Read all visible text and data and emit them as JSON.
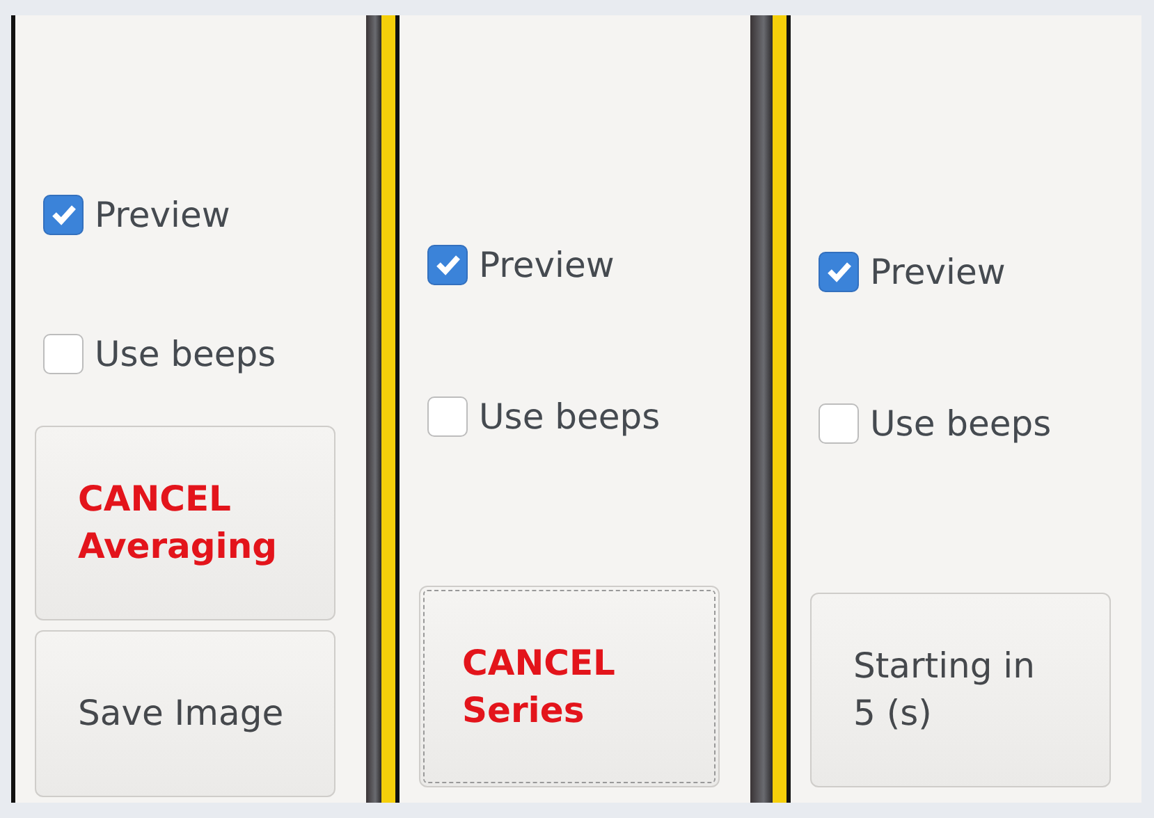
{
  "panels": [
    {
      "checkboxes": [
        {
          "label": "Preview",
          "checked": true
        },
        {
          "label": "Use beeps",
          "checked": false
        }
      ],
      "buttons": [
        {
          "kind": "cancel",
          "label": "CANCEL Averaging",
          "focused": false
        },
        {
          "kind": "normal",
          "label": "Save Image",
          "focused": false
        }
      ]
    },
    {
      "checkboxes": [
        {
          "label": "Preview",
          "checked": true
        },
        {
          "label": "Use beeps",
          "checked": false
        }
      ],
      "buttons": [
        {
          "kind": "cancel",
          "label": "CANCEL Series",
          "focused": true
        }
      ]
    },
    {
      "checkboxes": [
        {
          "label": "Preview",
          "checked": true
        },
        {
          "label": "Use beeps",
          "checked": false
        }
      ],
      "buttons": [
        {
          "kind": "normal",
          "label": "Starting in 5 (s)",
          "focused": false
        }
      ]
    }
  ]
}
